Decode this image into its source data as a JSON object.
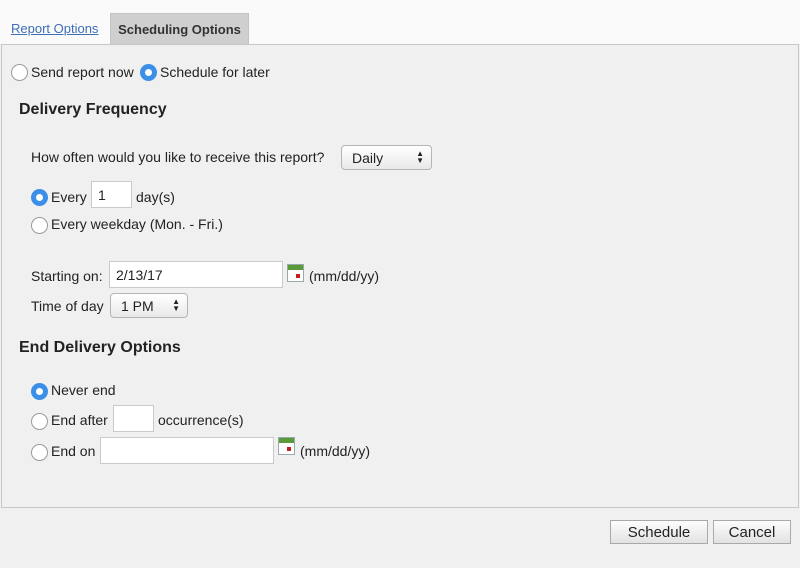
{
  "tabs": {
    "report_options": "Report Options",
    "scheduling_options": "Scheduling Options"
  },
  "send_mode": {
    "now_label": "Send report now",
    "later_label": "Schedule for later"
  },
  "delivery": {
    "heading": "Delivery Frequency",
    "question": "How often would you like to receive this report?",
    "frequency_value": "Daily",
    "every_label": "Every",
    "every_value": "1",
    "days_unit": "day(s)",
    "weekday_label": "Every weekday (Mon. - Fri.)",
    "starting_label": "Starting on:",
    "starting_value": "2/13/17",
    "date_format": "(mm/dd/yy)",
    "time_label": "Time of day",
    "time_value": "1 PM"
  },
  "end_options": {
    "heading": "End Delivery Options",
    "never_label": "Never end",
    "after_label": "End after",
    "after_value": "",
    "occurrence_unit": "occurrence(s)",
    "on_label": "End on",
    "on_value": "",
    "date_format": "(mm/dd/yy)"
  },
  "footer": {
    "schedule_label": "Schedule",
    "cancel_label": "Cancel"
  },
  "colors": {
    "accent": "#3b8fe8",
    "link": "#3d6fb6",
    "active_tab": "#cfcfcf"
  }
}
